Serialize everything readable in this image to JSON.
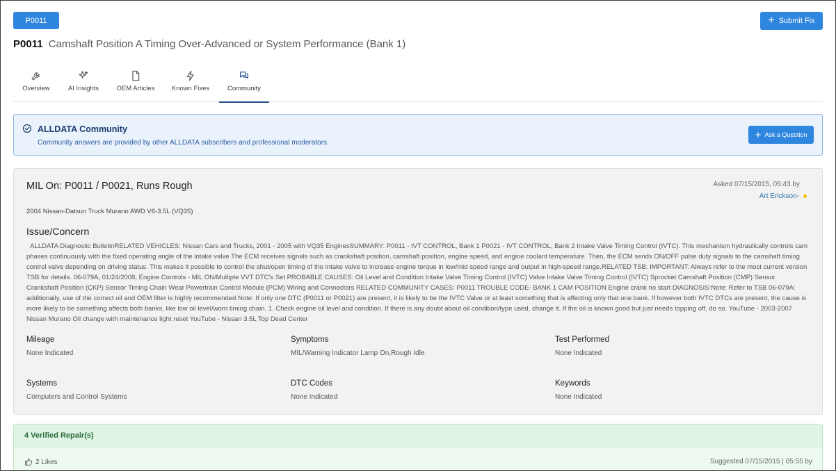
{
  "header": {
    "code_button": "P0011",
    "submit_label": "Submit Fix"
  },
  "title": {
    "code": "P0011",
    "description": "Camshaft Position A Timing Over-Advanced or System Performance (Bank 1)"
  },
  "tabs": [
    {
      "label": "Overview",
      "icon": "wrench-icon"
    },
    {
      "label": "AI Insights",
      "icon": "sparkle-icon"
    },
    {
      "label": "OEM Articles",
      "icon": "document-icon"
    },
    {
      "label": "Known Fixes",
      "icon": "lightning-icon"
    },
    {
      "label": "Community",
      "icon": "chat-bubbles-icon",
      "active": true
    }
  ],
  "community": {
    "title": "ALLDATA Community",
    "subtitle": "Community answers are provided by other ALLDATA subscribers and professional moderators.",
    "ask_label": "Ask a Question"
  },
  "question": {
    "title": "MIL On: P0011 / P0021, Runs Rough",
    "asked": "Asked 07/15/2015, 05:43 by",
    "author": "Art Erickson-",
    "vehicle": "2004 Nissan-Datsun Truck Murano AWD V6-3.5L (VQ35)",
    "issue_heading": "Issue/Concern",
    "issue_text": "ALLDATA Diagnostic BulletinRELATED VEHICLES: Nissan Cars and Trucks, 2001 - 2005 with VQ35 EnginesSUMMARY: P0011 - IVT CONTROL, Bank 1 P0021 - IVT CONTROL, Bank 2 Intake Valve Timing Control (IVTC). This mechanism hydraulically controls cam phases continuously with the fixed operating angle of the intake valve.The ECM receives signals such as crankshaft position, camshaft position, engine speed, and engine coolant temperature. Then, the ECM sends ON/OFF pulse duty signals to the camshaft timing control valve depending on driving status. This makes it possible to control the shut/open timing of the intake valve to increase engine torque in low/mid speed range and output in high-speed range.RELATED TSB: IMPORTANT: Always refer to the most current version TSB for details. 06-079A, 01/24/2008, Engine Controls - MIL ON/Multiple VVT DTC's Set PROBABLE CAUSES: Oil Level and Condition Intake Valve Timing Control (IVTC) Valve Intake Valve Timing Control (IVTC) Sprocket Camshaft Position (CMP) Sensor Crankshaft Position (CKP) Sensor Timing Chain Wear Powertrain Control Module (PCM) Wiring and Connectors RELATED COMMUNITY CASES: P0011 TROUBLE CODE- BANK 1 CAM POSITION Engine crank no start DIAGNOSIS:Note: Refer to TSB 06-079A: additionally, use of the correct oil and OEM filter is highly recommended.Note: If only one DTC (P0011 or P0021) are present, it is likely to be the IVTC Valve or at least something that is affecting only that one bank. If however both IVTC DTCs are present, the cause is more likely to be something affects both banks, like low oil level/worn timing chain. 1. Check engine oil level and condition. If there is any doubt about oil condition/type used, change it. If the oil is known good but just needs topping off, do so. YouTube - 2003-2007 Nissan Murano Oil change with maintenance light reset YouTube - Nissan 3.5L Top Dead Center",
    "fields": {
      "mileage": {
        "label": "Mileage",
        "value": "None Indicated"
      },
      "symptoms": {
        "label": "Symptoms",
        "value": "MIL/Warning Indicator Lamp On,Rough Idle"
      },
      "test_performed": {
        "label": "Test Performed",
        "value": "None Indicated"
      },
      "systems": {
        "label": "Systems",
        "value": "Computers and Control Systems"
      },
      "dtc_codes": {
        "label": "DTC Codes",
        "value": "None Indicated"
      },
      "keywords": {
        "label": "Keywords",
        "value": "None Indicated"
      }
    }
  },
  "repairs": {
    "heading": "4 Verified Repair(s)",
    "likes": "2 Likes",
    "suggested": "Suggested 07/15/2015 | 05:55 by"
  },
  "colors": {
    "accent": "#2e86de",
    "tab_underline": "#1f4e8c",
    "community_bg": "#eaf2fb",
    "repairs_bg": "#eefaf0"
  }
}
